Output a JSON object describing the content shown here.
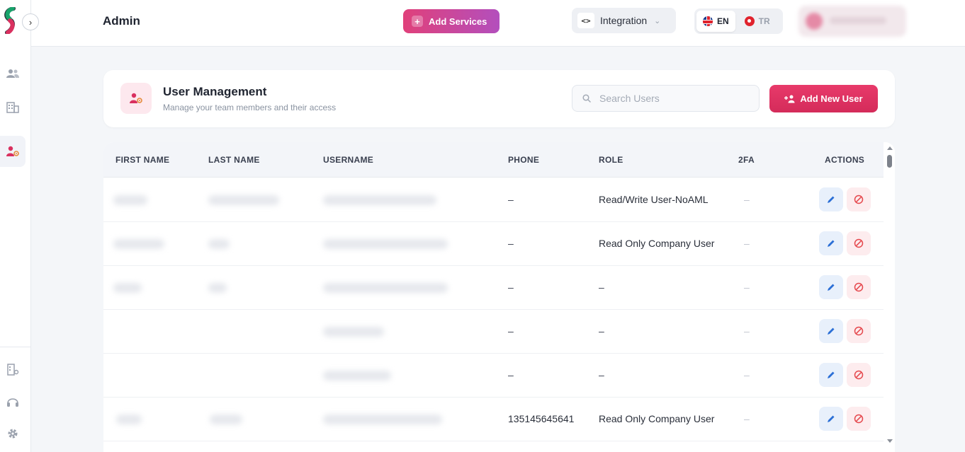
{
  "header": {
    "title": "Admin",
    "add_services_label": "Add Services",
    "integration_label": "Integration",
    "languages": [
      {
        "code": "EN",
        "active": true
      },
      {
        "code": "TR",
        "active": false
      }
    ]
  },
  "sidebar": {
    "items": [
      {
        "icon": "users-icon"
      },
      {
        "icon": "building-icon"
      },
      {
        "icon": "user-settings-icon",
        "active": true
      }
    ],
    "bottom_items": [
      {
        "icon": "building-settings-icon"
      },
      {
        "icon": "support-icon"
      },
      {
        "icon": "gear-icon"
      }
    ]
  },
  "user_management": {
    "title": "User Management",
    "subtitle": "Manage your team members and their access",
    "search_placeholder": "Search Users",
    "add_user_label": "Add New User"
  },
  "table": {
    "columns": [
      "FIRST NAME",
      "LAST NAME",
      "USERNAME",
      "PHONE",
      "ROLE",
      "2FA",
      "ACTIONS"
    ],
    "rows": [
      {
        "phone": "–",
        "role": "Read/Write User-NoAML",
        "twofa": "–"
      },
      {
        "phone": "–",
        "role": "Read Only Company User",
        "twofa": "–"
      },
      {
        "phone": "–",
        "role": "–",
        "twofa": "–"
      },
      {
        "phone": "–",
        "role": "–",
        "twofa": "–"
      },
      {
        "phone": "–",
        "role": "–",
        "twofa": "–"
      },
      {
        "phone": "135145645641",
        "role": "Read Only Company User",
        "twofa": "–"
      }
    ]
  },
  "colors": {
    "accent": "#d9305f",
    "edit_blue": "#2b6fd6",
    "delete_red": "#e5484d"
  }
}
